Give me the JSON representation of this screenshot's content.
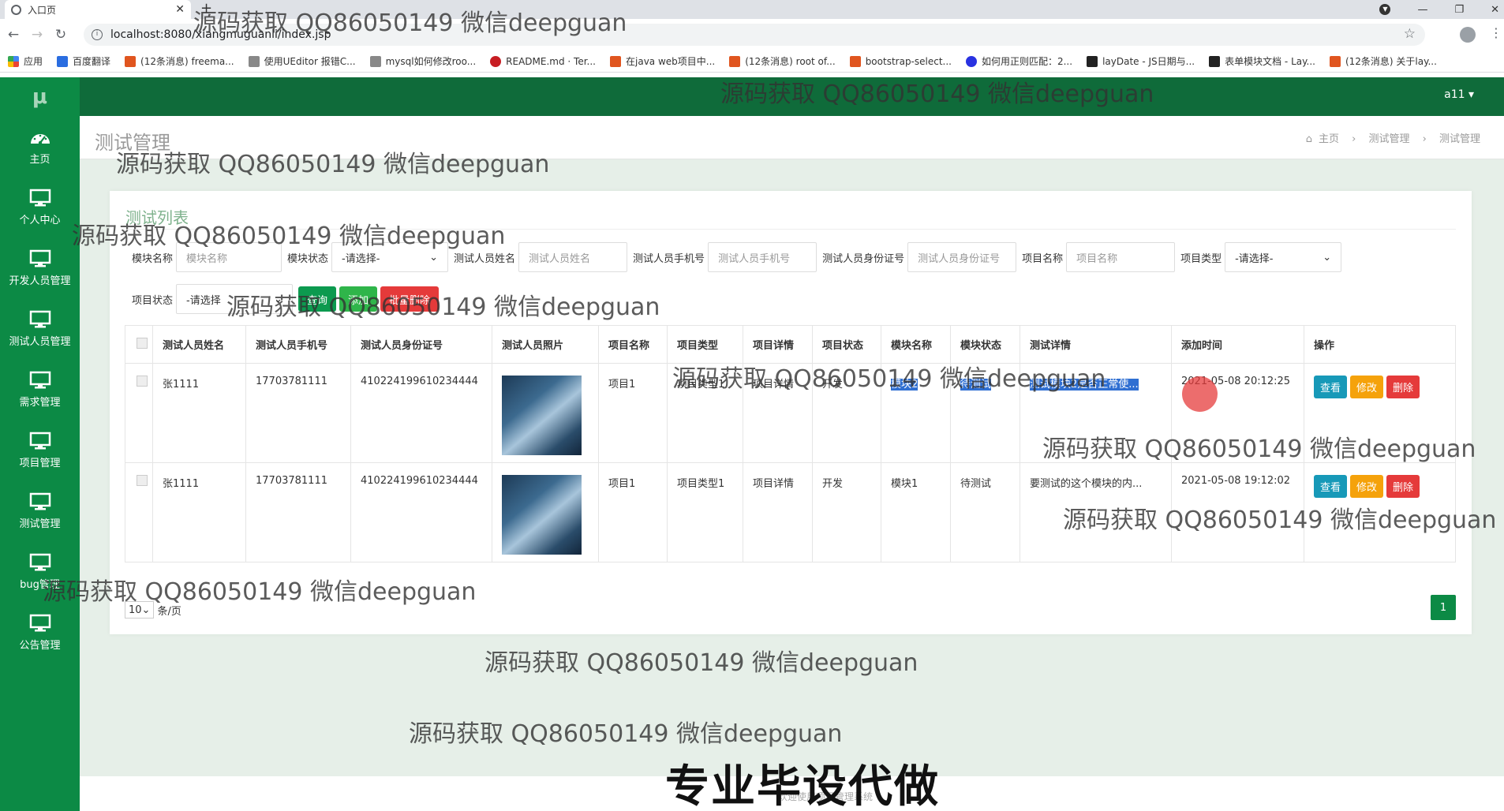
{
  "browser": {
    "tab_title": "入口页",
    "url": "localhost:8080/xiangmuguanli/index.jsp",
    "bookmarks": [
      "应用",
      "百度翻译",
      "(12条消息) freema...",
      "使用UEditor 报错C...",
      "mysql如何修改roo...",
      "README.md · Ter...",
      "在java web项目中...",
      "(12条消息) root of...",
      "bootstrap-select...",
      "如何用正则匹配：2...",
      "layDate - JS日期与...",
      "表单模块文档 - Lay...",
      "(12条消息) 关于lay..."
    ]
  },
  "header": {
    "logo": "μ",
    "user": "a11 ▾"
  },
  "sidebar": {
    "items": [
      {
        "label": "主页",
        "icon": "dashboard-icon"
      },
      {
        "label": "个人中心",
        "icon": "monitor-icon"
      },
      {
        "label": "开发人员管理",
        "icon": "monitor-icon"
      },
      {
        "label": "测试人员管理",
        "icon": "monitor-icon"
      },
      {
        "label": "需求管理",
        "icon": "monitor-icon"
      },
      {
        "label": "项目管理",
        "icon": "monitor-icon"
      },
      {
        "label": "测试管理",
        "icon": "monitor-icon"
      },
      {
        "label": "bug管理",
        "icon": "monitor-icon"
      },
      {
        "label": "公告管理",
        "icon": "monitor-icon"
      }
    ]
  },
  "page": {
    "title": "测试管理",
    "breadcrumb": [
      "主页",
      "测试管理",
      "测试管理"
    ],
    "panel_title": "测试列表"
  },
  "filters": {
    "module_name_label": "模块名称",
    "module_name_placeholder": "模块名称",
    "module_status_label": "模块状态",
    "module_status_value": "-请选择-",
    "tester_name_label": "测试人员姓名",
    "tester_name_placeholder": "测试人员姓名",
    "tester_phone_label": "测试人员手机号",
    "tester_phone_placeholder": "测试人员手机号",
    "tester_id_label": "测试人员身份证号",
    "tester_id_placeholder": "测试人员身份证号",
    "project_name_label": "项目名称",
    "project_name_placeholder": "项目名称",
    "project_type_label": "项目类型",
    "project_type_value": "-请选择-",
    "project_status_label": "项目状态",
    "project_status_value": "-请选择",
    "query_btn": "查询",
    "add_btn": "添加",
    "batch_delete_btn": "批量删除"
  },
  "table": {
    "columns": [
      "测试人员姓名",
      "测试人员手机号",
      "测试人员身份证号",
      "测试人员照片",
      "项目名称",
      "项目类型",
      "项目详情",
      "项目状态",
      "模块名称",
      "模块状态",
      "测试详情",
      "添加时间",
      "操作"
    ],
    "rows": [
      {
        "name": "张1111",
        "phone": "17703781111",
        "idcard": "410224199610234444",
        "project": "项目1",
        "ptype": "项目类型1",
        "pdetail": "项目详情",
        "pstatus": "开发",
        "module": "模块2",
        "mstatus": "待测试",
        "detail": "测试模块2是否正常使...",
        "time": "2021-05-08 20:12:25"
      },
      {
        "name": "张1111",
        "phone": "17703781111",
        "idcard": "410224199610234444",
        "project": "项目1",
        "ptype": "项目类型1",
        "pdetail": "项目详情",
        "pstatus": "开发",
        "module": "模块1",
        "mstatus": "待测试",
        "detail": "要测试的这个模块的内...",
        "time": "2021-05-08 19:12:02"
      }
    ],
    "op_view": "查看",
    "op_edit": "修改",
    "op_delete": "删除"
  },
  "pager": {
    "page_size": "10",
    "suffix": "条/页",
    "current_page": "1"
  },
  "footer": {
    "text": "欢迎使用项目管理系统"
  },
  "watermark": "源码获取 QQ86050149 微信deepguan",
  "banner": "专业毕设代做",
  "colors": {
    "primary": "#0c8a45",
    "header": "#0f6b3a",
    "danger": "#e53a3a",
    "info": "#1799b8",
    "warning": "#f5a20b"
  }
}
